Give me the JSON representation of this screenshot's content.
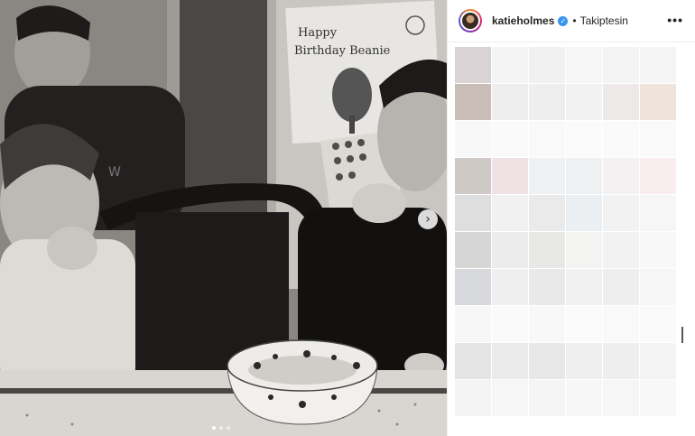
{
  "post": {
    "username": "katieholmes",
    "verified": true,
    "separator": "•",
    "follow_status": "Takiptesin",
    "more_label": "•••",
    "verified_glyph": "✓"
  },
  "photo": {
    "carousel_arrow_glyph": "›",
    "carousel_count": 3,
    "carousel_active_index": 0,
    "drawing_caption_line1": "Happy",
    "drawing_caption_line2": "Birthday Beanie"
  },
  "icons": {
    "more": "more-options-icon",
    "verified": "verified-badge-icon",
    "arrow": "chevron-right-icon"
  },
  "colors": {
    "verified_blue": "#3897f0",
    "text_primary": "#262626",
    "divider": "#efefef"
  }
}
